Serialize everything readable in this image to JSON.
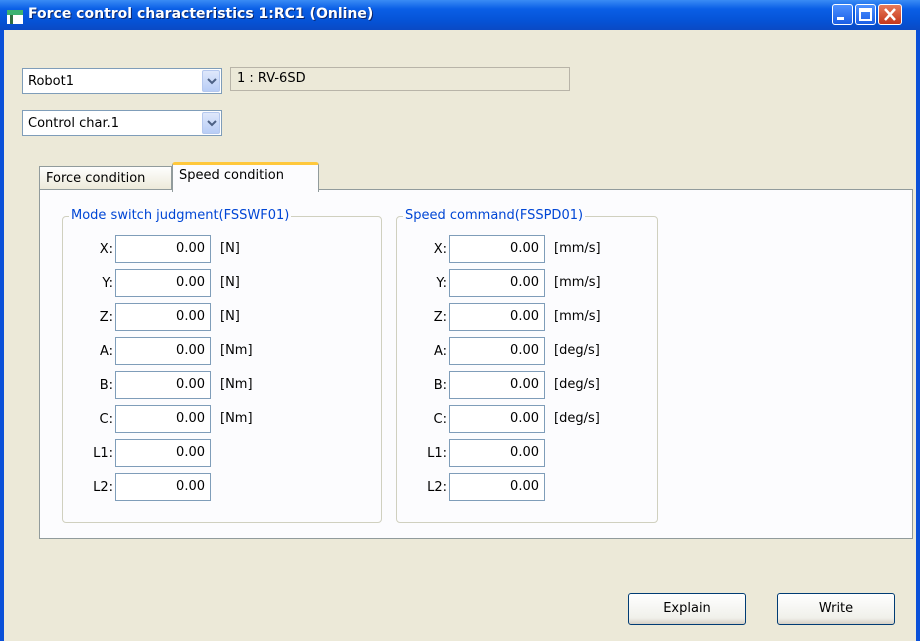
{
  "window": {
    "title": "Force control characteristics 1:RC1 (Online)"
  },
  "robot_select": {
    "value": "Robot1"
  },
  "robot_model": {
    "value": "1 : RV-6SD"
  },
  "char_select": {
    "value": "Control char.1"
  },
  "tabs": [
    {
      "label": "Force condition"
    },
    {
      "label": "Speed condition"
    }
  ],
  "mode_group": {
    "title": "Mode switch judgment(FSSWF01)",
    "rows": [
      {
        "label": "X:",
        "value": "0.00",
        "unit": "[N]"
      },
      {
        "label": "Y:",
        "value": "0.00",
        "unit": "[N]"
      },
      {
        "label": "Z:",
        "value": "0.00",
        "unit": "[N]"
      },
      {
        "label": "A:",
        "value": "0.00",
        "unit": "[Nm]"
      },
      {
        "label": "B:",
        "value": "0.00",
        "unit": "[Nm]"
      },
      {
        "label": "C:",
        "value": "0.00",
        "unit": "[Nm]"
      },
      {
        "label": "L1:",
        "value": "0.00",
        "unit": ""
      },
      {
        "label": "L2:",
        "value": "0.00",
        "unit": ""
      }
    ]
  },
  "speed_group": {
    "title": "Speed command(FSSPD01)",
    "rows": [
      {
        "label": "X:",
        "value": "0.00",
        "unit": "[mm/s]"
      },
      {
        "label": "Y:",
        "value": "0.00",
        "unit": "[mm/s]"
      },
      {
        "label": "Z:",
        "value": "0.00",
        "unit": "[mm/s]"
      },
      {
        "label": "A:",
        "value": "0.00",
        "unit": "[deg/s]"
      },
      {
        "label": "B:",
        "value": "0.00",
        "unit": "[deg/s]"
      },
      {
        "label": "C:",
        "value": "0.00",
        "unit": "[deg/s]"
      },
      {
        "label": "L1:",
        "value": "0.00",
        "unit": ""
      },
      {
        "label": "L2:",
        "value": "0.00",
        "unit": ""
      }
    ]
  },
  "buttons": {
    "explain": "Explain",
    "write": "Write"
  }
}
